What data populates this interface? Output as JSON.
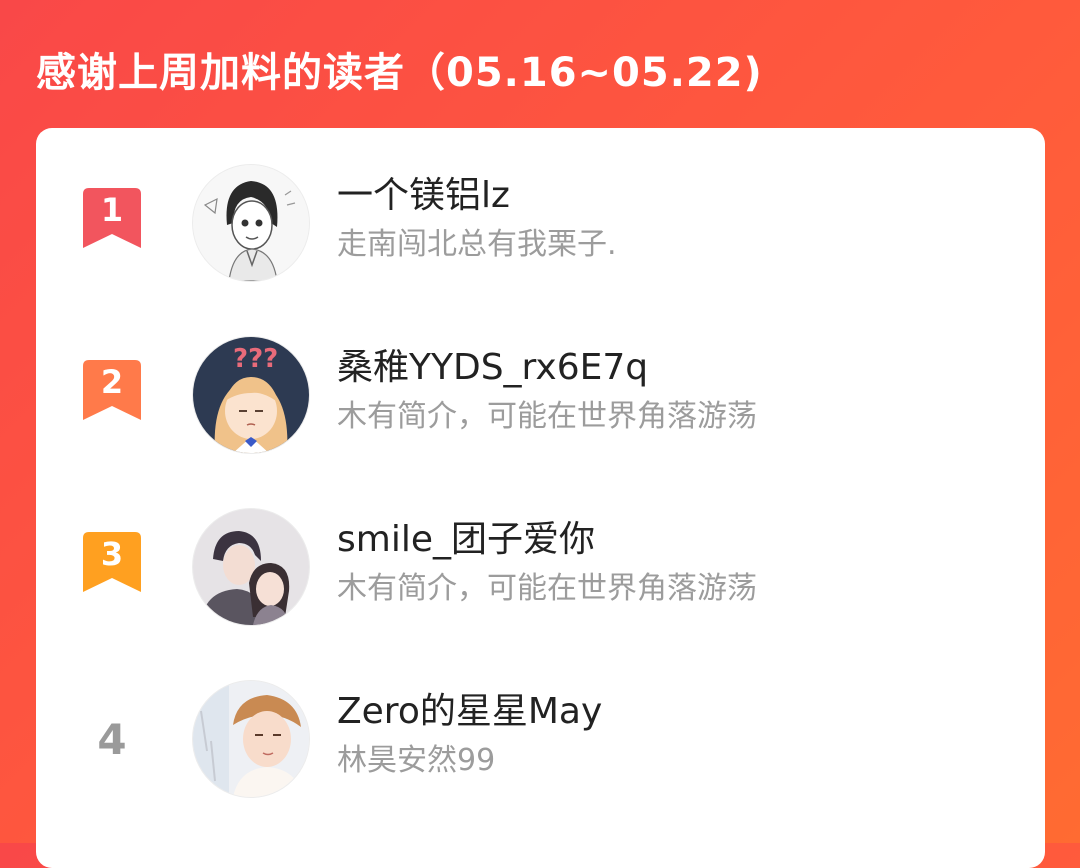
{
  "header": {
    "title": "感谢上周加料的读者（05.16~05.22)"
  },
  "colors": {
    "background_start": "#f94848",
    "background_end": "#ff6b32",
    "rank_1": "#f2555e",
    "rank_2": "#ff7a4a",
    "rank_3": "#ffa020",
    "rank_plain": "#9a9a9a"
  },
  "readers": [
    {
      "rank": "1",
      "badge": "red-ribbon-badge",
      "name": "一个镁铝lz",
      "bio": "走南闯北总有我栗子."
    },
    {
      "rank": "2",
      "badge": "orange-ribbon-badge",
      "name": "桑稚YYDS_rx6E7q",
      "bio": "木有简介，可能在世界角落游荡"
    },
    {
      "rank": "3",
      "badge": "amber-ribbon-badge",
      "name": "smile_团子爱你",
      "bio": "木有简介，可能在世界角落游荡"
    },
    {
      "rank": "4",
      "badge": "",
      "name": "Zero的星星May",
      "bio": "林昊安然99"
    }
  ]
}
